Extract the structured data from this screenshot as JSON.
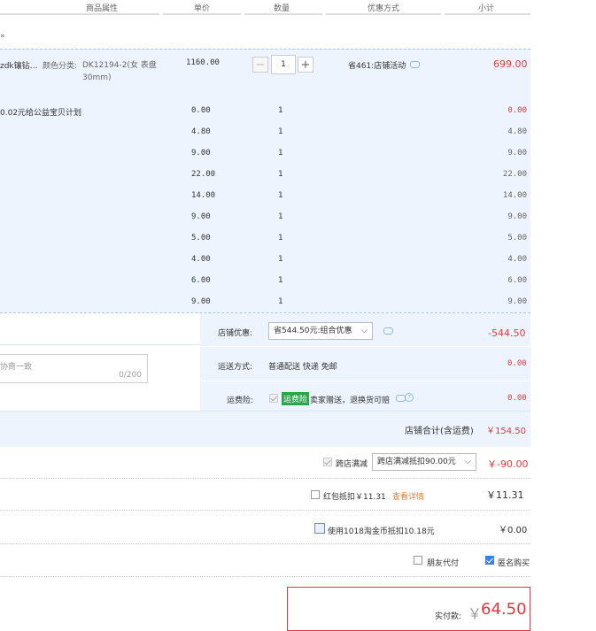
{
  "header": {
    "col_props": "商品属性",
    "col_price": "单价",
    "col_qty": "数量",
    "col_discount": "优惠方式",
    "col_subtotal": "小计"
  },
  "shop_row": {
    "text": "»"
  },
  "item": {
    "name": "zdk镶钻…",
    "prop_label": "颜色分类:",
    "prop_value": "DK12194-2(女 表盘30mm)",
    "price": "1160.00",
    "qty": "1",
    "qty_minus": "−",
    "qty_plus": "+",
    "discount": "省461:店铺活动",
    "subtotal": "699.00"
  },
  "addons": [
    {
      "name": "0.02元给公益宝贝计划",
      "price": "0.00",
      "qty": "1",
      "subtotal": "0.00"
    },
    {
      "name": "",
      "price": "4.80",
      "qty": "1",
      "subtotal": "4.80"
    },
    {
      "name": "",
      "price": "9.00",
      "qty": "1",
      "subtotal": "9.00"
    },
    {
      "name": "",
      "price": "22.00",
      "qty": "1",
      "subtotal": "22.00"
    },
    {
      "name": "",
      "price": "14.00",
      "qty": "1",
      "subtotal": "14.00"
    },
    {
      "name": "",
      "price": "9.00",
      "qty": "1",
      "subtotal": "9.00"
    },
    {
      "name": "",
      "price": "5.00",
      "qty": "1",
      "subtotal": "5.00"
    },
    {
      "name": "",
      "price": "4.00",
      "qty": "1",
      "subtotal": "4.00"
    },
    {
      "name": "",
      "price": "6.00",
      "qty": "1",
      "subtotal": "6.00"
    },
    {
      "name": "",
      "price": "9.00",
      "qty": "1",
      "subtotal": "9.00"
    }
  ],
  "shop_discount": {
    "label": "店铺优惠:",
    "selected": "省544.50元:组合优惠",
    "amount": "-544.50"
  },
  "message": {
    "placeholder": "协商一致",
    "counter": "0/200"
  },
  "shipping": {
    "label": "运送方式:",
    "value": "普通配送 快递 免邮",
    "amount": "0.00"
  },
  "insurance": {
    "label": "运费险:",
    "badge": "运费险",
    "text": "卖家赠送，退换货可赔",
    "amount": "0.00"
  },
  "shop_total": {
    "label": "店铺合计(含运费)",
    "amount": "￥154.50"
  },
  "cross_store": {
    "label": "跨店满减",
    "selected": "跨店满减抵扣90.00元",
    "amount": "￥-90.00"
  },
  "red_packet": {
    "label": "红包抵扣￥11.31",
    "link": "查看详情",
    "amount": "￥11.31"
  },
  "coins": {
    "label": "使用1018淘金币抵扣10.18元",
    "amount": "￥0.00"
  },
  "friend_pay": {
    "label": "朋友代付"
  },
  "anonymous": {
    "label": "匿名购买"
  },
  "final": {
    "label": "实付款:",
    "currency": "￥",
    "amount": "64.50"
  },
  "colors": {
    "accent_red": "#e4393c",
    "blue_bg": "#eef4fd",
    "checkbox_blue": "#3b82e0",
    "badge_green": "#2ea44f"
  }
}
